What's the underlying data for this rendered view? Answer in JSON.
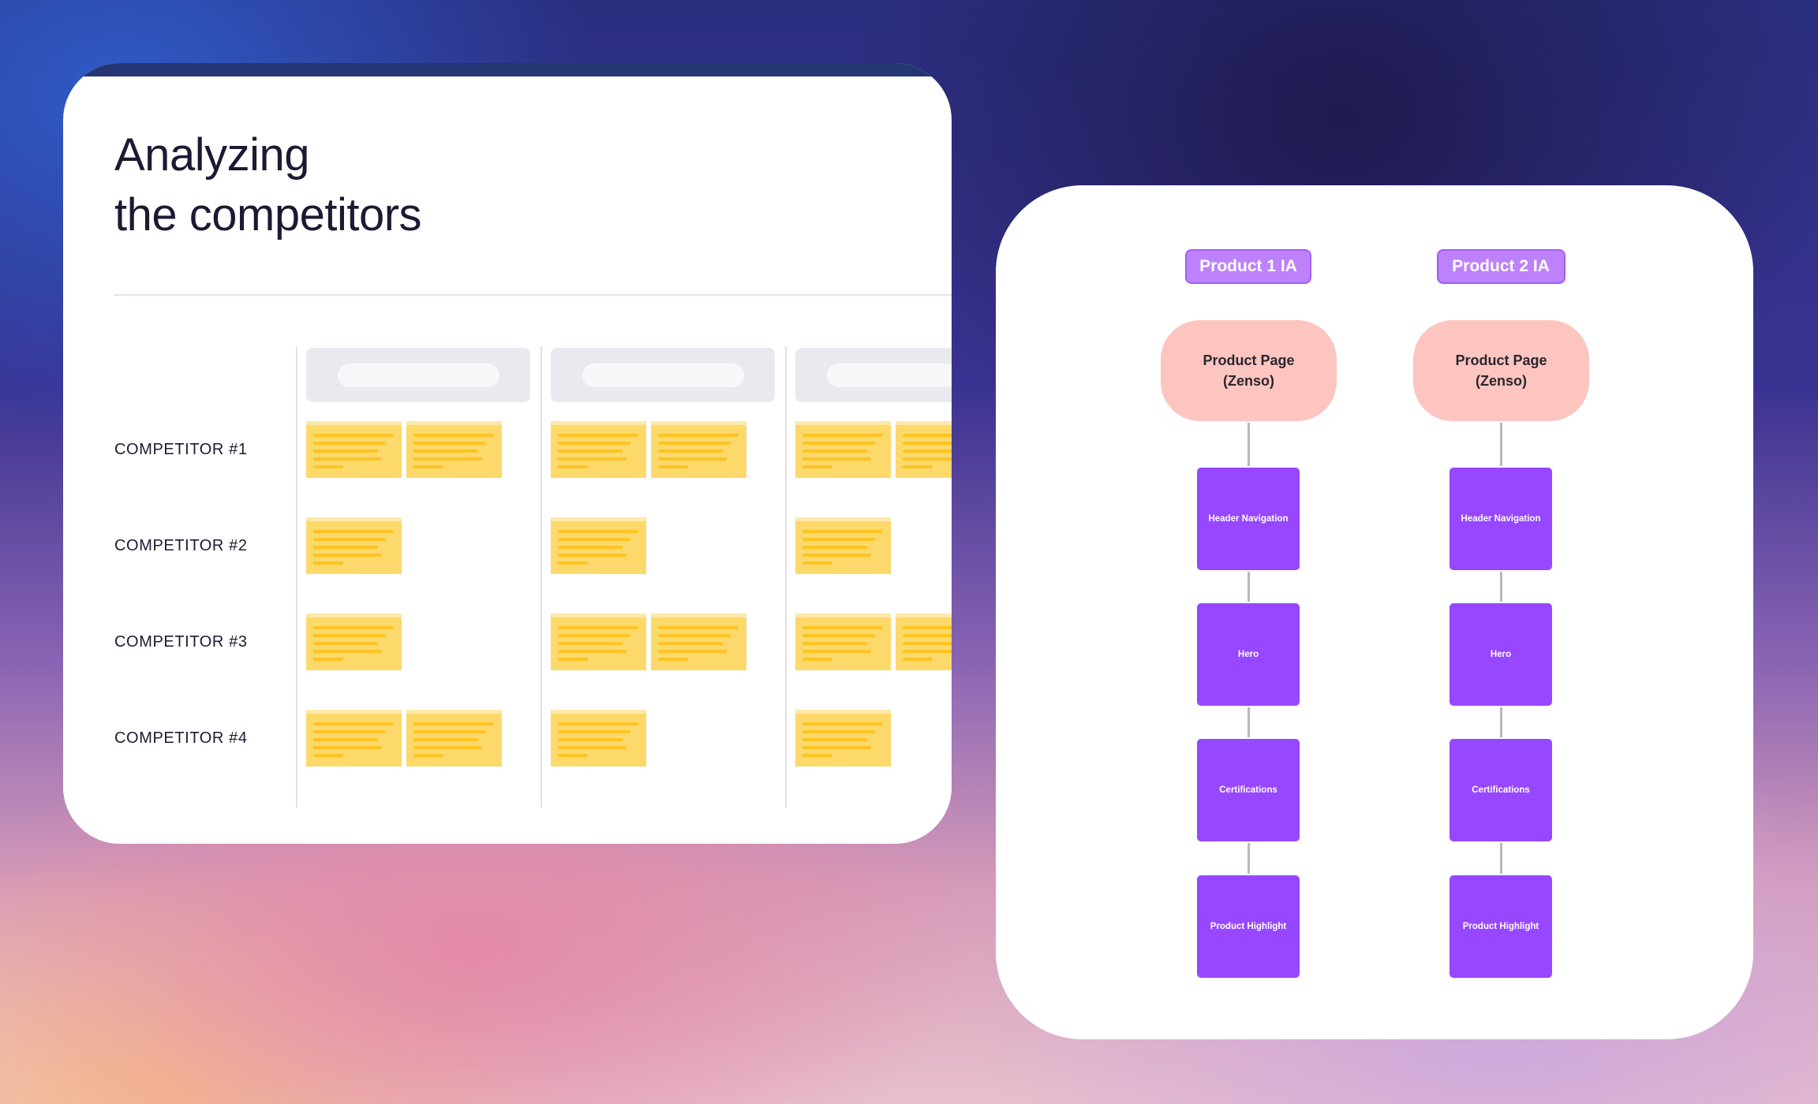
{
  "left_panel": {
    "title_line1": "Analyzing",
    "title_line2": "the competitors",
    "competitors": [
      "COMPETITOR #1",
      "COMPETITOR #2",
      "COMPETITOR #3",
      "COMPETITOR #4"
    ],
    "columns_visible": 3,
    "sticky_counts": [
      [
        2,
        2,
        2
      ],
      [
        1,
        1,
        1
      ],
      [
        1,
        2,
        2
      ],
      [
        2,
        1,
        1
      ]
    ]
  },
  "right_panel": {
    "trees": [
      {
        "label": "Product 1 IA",
        "root_line1": "Product Page",
        "root_line2": "(Zenso)",
        "nodes": [
          "Header Navigation",
          "Hero",
          "Certifications",
          "Product Highlight"
        ]
      },
      {
        "label": "Product 2 IA",
        "root_line1": "Product Page",
        "root_line2": "(Zenso)",
        "nodes": [
          "Header Navigation",
          "Hero",
          "Certifications",
          "Product Highlight"
        ]
      }
    ]
  },
  "colors": {
    "label_purple": "#bd82fb",
    "node_purple": "#9747ff",
    "root_pink": "#fcc5bf",
    "sticky_yellow": "#fdd86b",
    "navy_band": "#243673"
  }
}
